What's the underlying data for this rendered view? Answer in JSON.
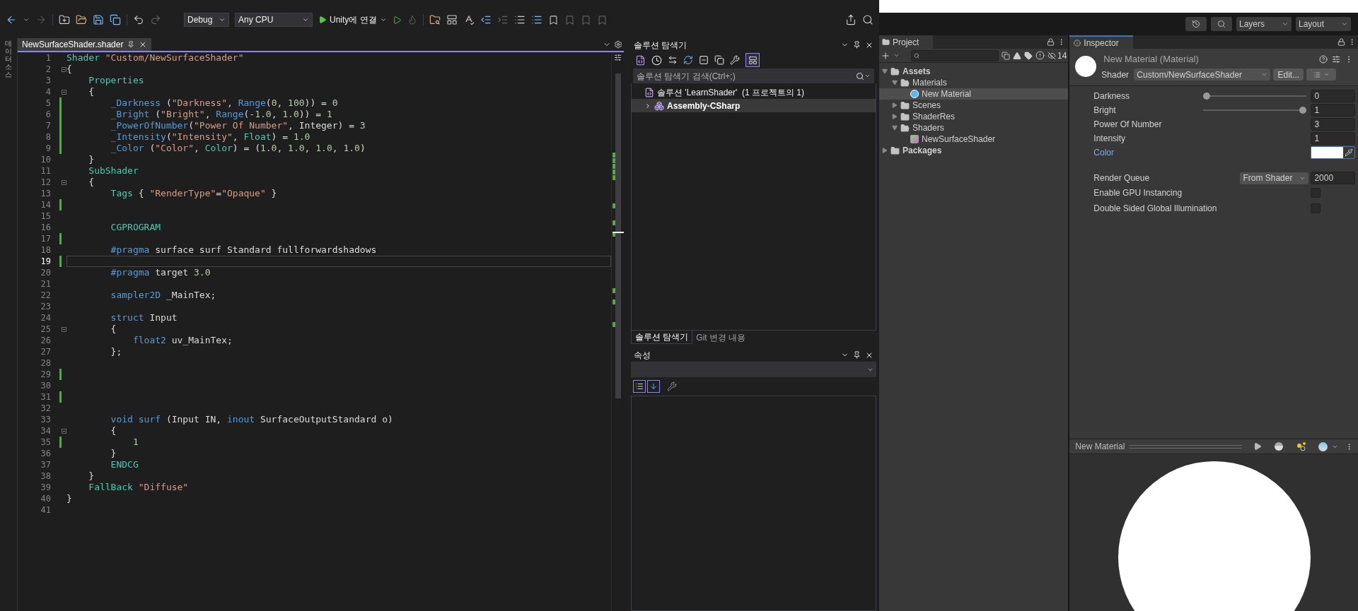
{
  "vs": {
    "toolbar": {
      "configuration": "Debug",
      "platform": "Any CPU",
      "run_target": "Unity에 연결"
    },
    "side_tab": "데이터 소스",
    "editor_tabs": [
      {
        "label": "NewSurfaceShader.shader",
        "selected": true
      }
    ],
    "code_lines": [
      {
        "number": "1",
        "changed": false,
        "current": false,
        "foldable": false,
        "tokens": [
          {
            "kind": "type",
            "text": "Shader"
          },
          {
            "kind": "string",
            "text": " \"Custom/NewSurfaceShader\""
          }
        ]
      },
      {
        "number": "2",
        "changed": false,
        "current": false,
        "foldable": true,
        "tokens": [
          {
            "kind": "plain",
            "text": "{"
          }
        ]
      },
      {
        "number": "3",
        "changed": false,
        "current": false,
        "foldable": false,
        "tokens": [
          {
            "kind": "type",
            "text": "    Properties"
          }
        ]
      },
      {
        "number": "4",
        "changed": false,
        "current": false,
        "foldable": true,
        "tokens": [
          {
            "kind": "plain",
            "text": "    {"
          }
        ]
      },
      {
        "number": "5",
        "changed": true,
        "current": false,
        "foldable": false,
        "tokens": [
          {
            "kind": "keyword",
            "text": "        _Darkness"
          },
          {
            "kind": "plain",
            "text": " ("
          },
          {
            "kind": "string",
            "text": "\"Darkness\""
          },
          {
            "kind": "plain",
            "text": ", "
          },
          {
            "kind": "keyword",
            "text": "Range"
          },
          {
            "kind": "plain",
            "text": "("
          },
          {
            "kind": "number",
            "text": "0"
          },
          {
            "kind": "plain",
            "text": ", "
          },
          {
            "kind": "number",
            "text": "100"
          },
          {
            "kind": "plain",
            "text": ")) = "
          },
          {
            "kind": "number",
            "text": "0"
          }
        ]
      },
      {
        "number": "6",
        "changed": true,
        "current": false,
        "foldable": false,
        "tokens": [
          {
            "kind": "keyword",
            "text": "        _Bright"
          },
          {
            "kind": "plain",
            "text": " ("
          },
          {
            "kind": "string",
            "text": "\"Bright\""
          },
          {
            "kind": "plain",
            "text": ", "
          },
          {
            "kind": "keyword",
            "text": "Range"
          },
          {
            "kind": "plain",
            "text": "("
          },
          {
            "kind": "number",
            "text": "-1.0"
          },
          {
            "kind": "plain",
            "text": ", "
          },
          {
            "kind": "number",
            "text": "1.0"
          },
          {
            "kind": "plain",
            "text": ")) = "
          },
          {
            "kind": "number",
            "text": "1"
          }
        ]
      },
      {
        "number": "7",
        "changed": true,
        "current": false,
        "foldable": false,
        "tokens": [
          {
            "kind": "keyword",
            "text": "        _PowerOfNumber"
          },
          {
            "kind": "plain",
            "text": "("
          },
          {
            "kind": "string",
            "text": "\"Power Of Number\""
          },
          {
            "kind": "plain",
            "text": ", Integer) = "
          },
          {
            "kind": "number",
            "text": "3"
          }
        ]
      },
      {
        "number": "8",
        "changed": true,
        "current": false,
        "foldable": false,
        "tokens": [
          {
            "kind": "keyword",
            "text": "        _Intensity"
          },
          {
            "kind": "plain",
            "text": "("
          },
          {
            "kind": "string",
            "text": "\"Intensity\""
          },
          {
            "kind": "plain",
            "text": ", "
          },
          {
            "kind": "type",
            "text": "Float"
          },
          {
            "kind": "plain",
            "text": ") = "
          },
          {
            "kind": "number",
            "text": "1.0"
          }
        ]
      },
      {
        "number": "9",
        "changed": true,
        "current": false,
        "foldable": false,
        "tokens": [
          {
            "kind": "keyword",
            "text": "        _Color"
          },
          {
            "kind": "plain",
            "text": " ("
          },
          {
            "kind": "string",
            "text": "\"Color\""
          },
          {
            "kind": "plain",
            "text": ", "
          },
          {
            "kind": "type",
            "text": "Color"
          },
          {
            "kind": "plain",
            "text": ") = ("
          },
          {
            "kind": "number",
            "text": "1.0"
          },
          {
            "kind": "plain",
            "text": ", "
          },
          {
            "kind": "number",
            "text": "1.0"
          },
          {
            "kind": "plain",
            "text": ", "
          },
          {
            "kind": "number",
            "text": "1.0"
          },
          {
            "kind": "plain",
            "text": ", "
          },
          {
            "kind": "number",
            "text": "1.0"
          },
          {
            "kind": "plain",
            "text": ")"
          }
        ]
      },
      {
        "number": "10",
        "changed": false,
        "current": false,
        "foldable": false,
        "tokens": [
          {
            "kind": "plain",
            "text": "    }"
          }
        ]
      },
      {
        "number": "11",
        "changed": false,
        "current": false,
        "foldable": false,
        "tokens": [
          {
            "kind": "type",
            "text": "    SubShader"
          }
        ]
      },
      {
        "number": "12",
        "changed": false,
        "current": false,
        "foldable": true,
        "tokens": [
          {
            "kind": "plain",
            "text": "    {"
          }
        ]
      },
      {
        "number": "13",
        "changed": false,
        "current": false,
        "foldable": false,
        "tokens": [
          {
            "kind": "type",
            "text": "        Tags"
          },
          {
            "kind": "plain",
            "text": " { "
          },
          {
            "kind": "string",
            "text": "\"RenderType\""
          },
          {
            "kind": "plain",
            "text": "="
          },
          {
            "kind": "string",
            "text": "\"Opaque\""
          },
          {
            "kind": "plain",
            "text": " }"
          }
        ]
      },
      {
        "number": "14",
        "changed": true,
        "current": false,
        "foldable": false
      },
      {
        "number": "15",
        "changed": false,
        "current": false,
        "foldable": false
      },
      {
        "number": "16",
        "changed": false,
        "current": false,
        "foldable": false,
        "tokens": [
          {
            "kind": "type",
            "text": "        CGPROGRAM"
          }
        ]
      },
      {
        "number": "17",
        "changed": true,
        "current": false,
        "foldable": false
      },
      {
        "number": "18",
        "changed": false,
        "current": false,
        "foldable": false,
        "tokens": [
          {
            "kind": "keyword",
            "text": "        #pragma"
          },
          {
            "kind": "plain",
            "text": " surface surf Standard fullforwardshadows"
          }
        ]
      },
      {
        "number": "19",
        "changed": true,
        "current": true,
        "foldable": false
      },
      {
        "number": "20",
        "changed": false,
        "current": false,
        "foldable": false,
        "tokens": [
          {
            "kind": "keyword",
            "text": "        #pragma"
          },
          {
            "kind": "plain",
            "text": " target "
          },
          {
            "kind": "number",
            "text": "3.0"
          }
        ]
      },
      {
        "number": "21",
        "changed": false,
        "current": false,
        "foldable": false
      },
      {
        "number": "22",
        "changed": false,
        "current": false,
        "foldable": false,
        "tokens": [
          {
            "kind": "keyword",
            "text": "        sampler2D"
          },
          {
            "kind": "plain",
            "text": " _MainTex;"
          }
        ]
      },
      {
        "number": "23",
        "changed": false,
        "current": false,
        "foldable": false
      },
      {
        "number": "24",
        "changed": false,
        "current": false,
        "foldable": false,
        "tokens": [
          {
            "kind": "keyword",
            "text": "        struct"
          },
          {
            "kind": "plain",
            "text": " Input"
          }
        ]
      },
      {
        "number": "25",
        "changed": false,
        "current": false,
        "foldable": true,
        "tokens": [
          {
            "kind": "plain",
            "text": "        {"
          }
        ]
      },
      {
        "number": "26",
        "changed": false,
        "current": false,
        "foldable": false,
        "tokens": [
          {
            "kind": "keyword",
            "text": "            float2"
          },
          {
            "kind": "plain",
            "text": " uv_MainTex;"
          }
        ]
      },
      {
        "number": "27",
        "changed": false,
        "current": false,
        "foldable": false,
        "tokens": [
          {
            "kind": "plain",
            "text": "        };"
          }
        ]
      },
      {
        "number": "28",
        "changed": false,
        "current": false,
        "foldable": false
      },
      {
        "number": "29",
        "changed": true,
        "current": false,
        "foldable": false
      },
      {
        "number": "30",
        "changed": false,
        "current": false,
        "foldable": false
      },
      {
        "number": "31",
        "changed": true,
        "current": false,
        "foldable": false
      },
      {
        "number": "32",
        "changed": false,
        "current": false,
        "foldable": false
      },
      {
        "number": "33",
        "changed": false,
        "current": false,
        "foldable": false,
        "tokens": [
          {
            "kind": "keyword",
            "text": "        void"
          },
          {
            "kind": "keyword",
            "text": " surf"
          },
          {
            "kind": "plain",
            "text": " (Input IN, "
          },
          {
            "kind": "keyword",
            "text": "inout"
          },
          {
            "kind": "plain",
            "text": " SurfaceOutputStandard o)"
          }
        ]
      },
      {
        "number": "34",
        "changed": false,
        "current": false,
        "foldable": true,
        "tokens": [
          {
            "kind": "plain",
            "text": "        {"
          }
        ]
      },
      {
        "number": "35",
        "changed": true,
        "current": false,
        "foldable": false,
        "tokens": [
          {
            "kind": "number",
            "text": "            1"
          }
        ]
      },
      {
        "number": "36",
        "changed": false,
        "current": false,
        "foldable": false,
        "tokens": [
          {
            "kind": "plain",
            "text": "        }"
          }
        ]
      },
      {
        "number": "37",
        "changed": false,
        "current": false,
        "foldable": false,
        "tokens": [
          {
            "kind": "type",
            "text": "        ENDCG"
          }
        ]
      },
      {
        "number": "38",
        "changed": false,
        "current": false,
        "foldable": false,
        "tokens": [
          {
            "kind": "plain",
            "text": "    }"
          }
        ]
      },
      {
        "number": "39",
        "changed": false,
        "current": false,
        "foldable": false,
        "tokens": [
          {
            "kind": "type",
            "text": "    FallBack"
          },
          {
            "kind": "string",
            "text": " \"Diffuse\""
          }
        ]
      },
      {
        "number": "40",
        "changed": false,
        "current": false,
        "foldable": false,
        "tokens": [
          {
            "kind": "plain",
            "text": "}"
          }
        ]
      },
      {
        "number": "41",
        "changed": false,
        "current": false,
        "foldable": false
      }
    ],
    "solution_explorer": {
      "title": "솔루션 탐색기",
      "preview_on": true,
      "search_placeholder": "솔루션 탐색기 검색(Ctrl+;)",
      "tree": [
        {
          "label": "솔루션 'LearnShader'  (1 프로젝트의 1)",
          "kind": "solution",
          "selected": false,
          "children": [
            {
              "label": "Assembly-CSharp",
              "kind": "project",
              "selected": true,
              "expanded": false
            }
          ]
        }
      ],
      "tabs": [
        {
          "label": "솔루션 탐색기",
          "selected": true
        },
        {
          "label": "Git 변경 내용",
          "selected": false
        }
      ]
    },
    "properties_panel": {
      "title": "속성",
      "view_toggles": [
        {
          "kind": "categorized",
          "on": true
        },
        {
          "kind": "alphabetical",
          "on": true
        }
      ]
    }
  },
  "unity": {
    "toolbar": {
      "layers": "Layers",
      "layout": "Layout"
    },
    "project": {
      "title": "Project",
      "hidden_count": "14",
      "tree": [
        {
          "label": "Assets",
          "kind": "folder",
          "expanded": true,
          "selected": false,
          "children": [
            {
              "label": "Materials",
              "kind": "folder",
              "expanded": true,
              "selected": false,
              "children": [
                {
                  "label": "New Material",
                  "kind": "material",
                  "selected": true
                }
              ]
            },
            {
              "label": "Scenes",
              "kind": "folder",
              "expanded": false,
              "selected": false
            },
            {
              "label": "ShaderRes",
              "kind": "folder",
              "expanded": false,
              "selected": false
            },
            {
              "label": "Shaders",
              "kind": "folder",
              "expanded": true,
              "selected": false,
              "children": [
                {
                  "label": "NewSurfaceShader",
                  "kind": "shader",
                  "selected": false
                }
              ]
            }
          ]
        },
        {
          "label": "Packages",
          "kind": "folder",
          "expanded": false,
          "selected": false
        }
      ]
    },
    "inspector": {
      "title": "Inspector",
      "material_name": "New Material (Material)",
      "shader_label": "Shader",
      "shader": "Custom/NewSurfaceShader",
      "edit_button": "Edit...",
      "properties": [
        {
          "kind": "slider",
          "label": "Darkness",
          "level": 0,
          "value": "0"
        },
        {
          "kind": "slider",
          "label": "Bright",
          "level": 1,
          "value": "1"
        },
        {
          "kind": "number",
          "label": "Power Of Number",
          "value": "3"
        },
        {
          "kind": "number",
          "label": "Intensity",
          "value": "1"
        },
        {
          "kind": "color",
          "label": "Color",
          "color": "#ffffff",
          "focused": true
        }
      ],
      "render_queue": {
        "label": "Render Queue",
        "mode": "From Shader",
        "value": "2000"
      },
      "options": [
        {
          "label": "Enable GPU Instancing",
          "checked": false
        },
        {
          "label": "Double Sided Global Illumination",
          "checked": false
        }
      ],
      "preview": {
        "title": "New Material"
      }
    }
  }
}
